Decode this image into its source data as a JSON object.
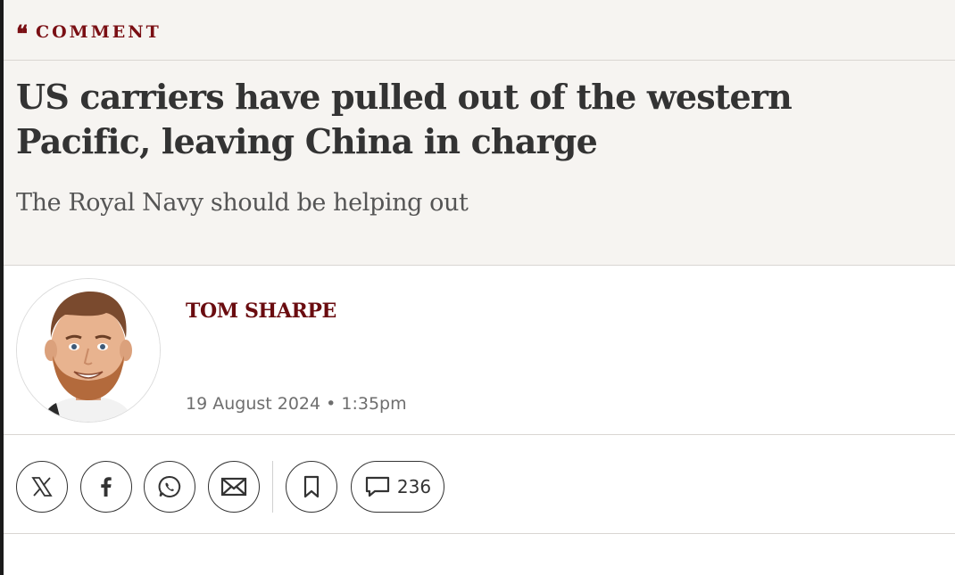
{
  "section": {
    "kicker": "COMMENT",
    "quote_glyph": "❝"
  },
  "article": {
    "headline": "US carriers have pulled out of the western Pacific, leaving China in charge",
    "standfirst": "The Royal Navy should be helping out"
  },
  "byline": {
    "author": "TOM SHARPE",
    "date": "19 August 2024 • 1:35pm"
  },
  "share": {
    "icons": [
      "x-logo-icon",
      "facebook-icon",
      "whatsapp-icon",
      "email-icon",
      "bookmark-icon",
      "comment-icon"
    ],
    "comment_count": "236"
  },
  "colors": {
    "accent": "#7a0f14",
    "hero_bg": "#f6f4f1",
    "text": "#333333"
  }
}
